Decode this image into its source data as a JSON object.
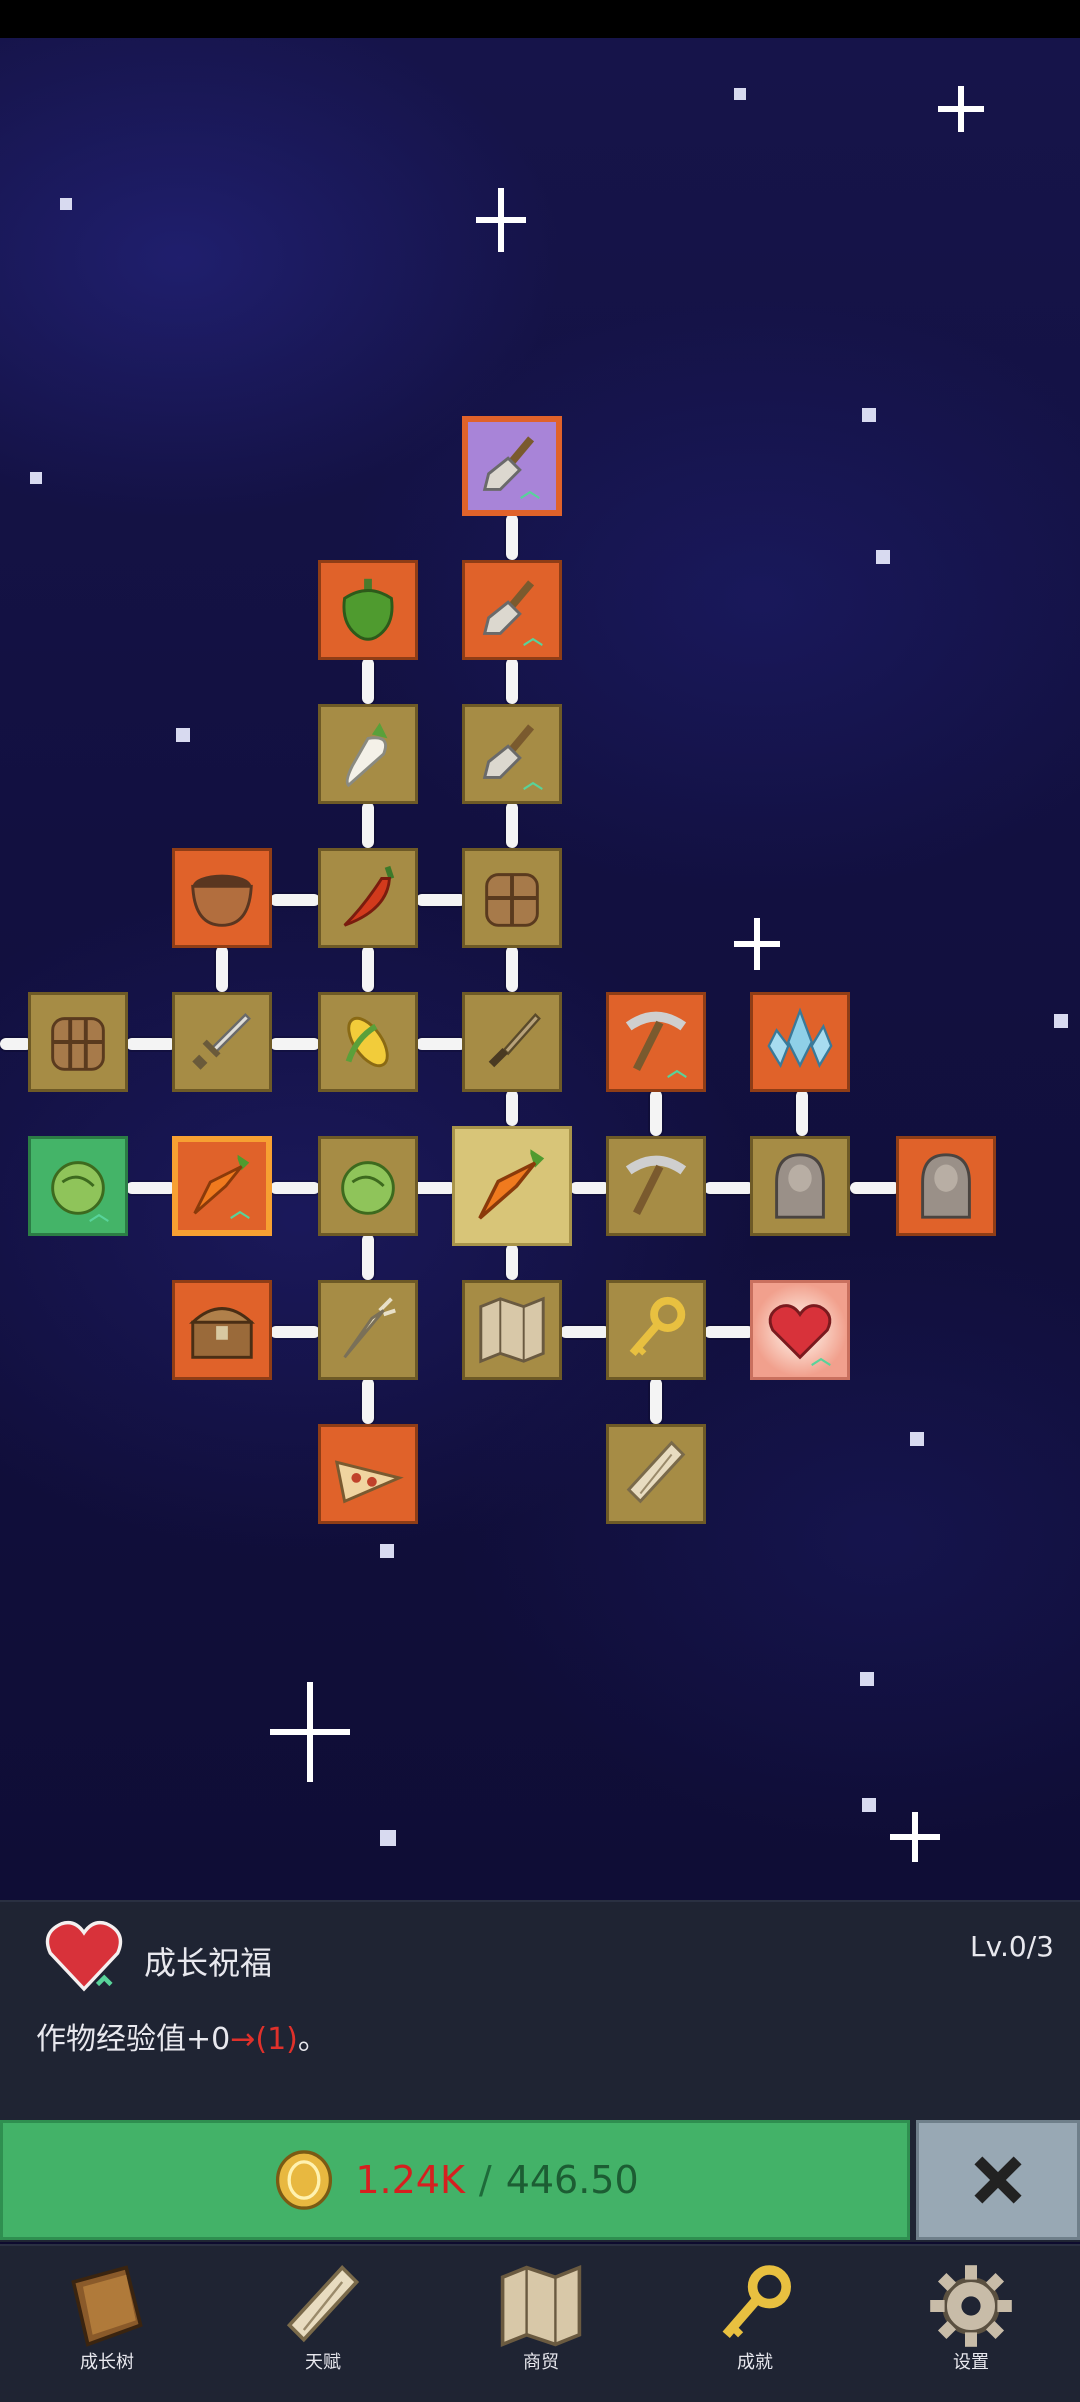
{
  "skill_tree": {
    "nodes": [
      {
        "id": "n-shovel-purple",
        "icon": "shovel-icon",
        "upgrade": true
      },
      {
        "id": "n-pepper",
        "icon": "green-pepper-icon"
      },
      {
        "id": "n-shovel-orange",
        "icon": "shovel-icon",
        "upgrade": true
      },
      {
        "id": "n-radish",
        "icon": "white-radish-icon"
      },
      {
        "id": "n-shovel",
        "icon": "shovel-icon",
        "upgrade": true
      },
      {
        "id": "n-bowl",
        "icon": "bowl-icon"
      },
      {
        "id": "n-chili",
        "icon": "chili-icon"
      },
      {
        "id": "n-chest-brown",
        "icon": "backpack-icon"
      },
      {
        "id": "n-barrel",
        "icon": "crate-icon"
      },
      {
        "id": "n-sword",
        "icon": "sword-icon"
      },
      {
        "id": "n-corn",
        "icon": "corn-icon"
      },
      {
        "id": "n-dagger",
        "icon": "dagger-icon"
      },
      {
        "id": "n-pickaxe-orange",
        "icon": "pickaxe-icon",
        "upgrade": true
      },
      {
        "id": "n-crystal",
        "icon": "crystal-icon"
      },
      {
        "id": "n-cabbage-green",
        "icon": "cabbage-icon",
        "upgrade": true
      },
      {
        "id": "n-carrot-orange",
        "icon": "carrot-icon",
        "upgrade": true
      },
      {
        "id": "n-cabbage",
        "icon": "cabbage-icon"
      },
      {
        "id": "n-carrot-center",
        "icon": "carrot-icon"
      },
      {
        "id": "n-pickaxe",
        "icon": "pickaxe-icon"
      },
      {
        "id": "n-statue",
        "icon": "statue-icon"
      },
      {
        "id": "n-statue-orange",
        "icon": "statue-icon"
      },
      {
        "id": "n-treasure-chest",
        "icon": "treasure-chest-icon"
      },
      {
        "id": "n-parsnip",
        "icon": "parsnip-icon"
      },
      {
        "id": "n-map",
        "icon": "map-icon"
      },
      {
        "id": "n-key",
        "icon": "key-icon"
      },
      {
        "id": "n-heart",
        "icon": "heart-icon",
        "upgrade": true
      },
      {
        "id": "n-pizza",
        "icon": "pizza-icon"
      },
      {
        "id": "n-scroll",
        "icon": "scroll-icon"
      }
    ]
  },
  "panel": {
    "title": "成长祝福",
    "level": "Lv.0/3",
    "desc_prefix": "作物经验值+0",
    "desc_arrow": "→(1)",
    "desc_suffix": "。",
    "icon": "heart-icon"
  },
  "buy_button": {
    "cost": "1.24K",
    "separator": "/",
    "have": "446.50",
    "icon": "coin-icon"
  },
  "close_button": {
    "icon": "close-icon"
  },
  "nav": {
    "items": [
      {
        "label": "成长树",
        "icon": "book-icon"
      },
      {
        "label": "天赋",
        "icon": "scroll-icon"
      },
      {
        "label": "商贸",
        "icon": "map-icon"
      },
      {
        "label": "成就",
        "icon": "key-icon"
      },
      {
        "label": "设置",
        "icon": "gear-icon"
      }
    ]
  },
  "colors": {
    "sky": "#121040",
    "node_gold": "#a68c45",
    "node_orange": "#e0622a",
    "node_green": "#44b468",
    "button_green": "#43b268",
    "cost_red": "#d61f1f",
    "panel": "#1f2433"
  }
}
